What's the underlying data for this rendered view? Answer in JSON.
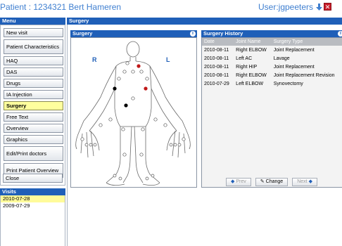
{
  "header": {
    "patient_title": "Patient : 1234321 Bert Hameren",
    "user_label": "User:jgpeeters"
  },
  "sidebar": {
    "menu_title": "Menu",
    "items": [
      {
        "label": "New visit"
      },
      {
        "label": "Patient Characteristics"
      },
      {
        "label": "HAQ"
      },
      {
        "label": "DAS"
      },
      {
        "label": "Drugs"
      },
      {
        "label": "IA Injection"
      },
      {
        "label": "Surgery"
      },
      {
        "label": "Free Text"
      },
      {
        "label": "Overview"
      },
      {
        "label": "Graphics"
      },
      {
        "label": "Edit/Print doctors"
      },
      {
        "label": "Print Patient Overview"
      },
      {
        "label": "Close"
      }
    ],
    "visits_title": "Visits",
    "visits": [
      "2010-07-28",
      "2009-07-29"
    ]
  },
  "main": {
    "title": "Surgery",
    "surgery_panel_title": "Surgery",
    "body_left_label": "R",
    "body_right_label": "L",
    "history_title": "Surgery History",
    "history_columns": [
      "Date",
      "Joint Name",
      "Surgery Type"
    ],
    "history_rows": [
      [
        "2010-08-11",
        "Right ELBOW",
        "Joint Replacement"
      ],
      [
        "2010-08-11",
        "Left AC",
        "Lavage"
      ],
      [
        "2010-08-11",
        "Right HIP",
        "Joint Replacement"
      ],
      [
        "2010-08-11",
        "Right ELBOW",
        "Joint Replacement Revision"
      ],
      [
        "2010-07-29",
        "Left ELBOW",
        "Synovectomy"
      ]
    ],
    "pager": {
      "prev": "Prev",
      "change": "Change",
      "next": "Next"
    }
  },
  "colors": {
    "accent": "#1f5fb8",
    "selected": "#ffff9e",
    "marker_red": "#c01818",
    "marker_black": "#000000"
  }
}
